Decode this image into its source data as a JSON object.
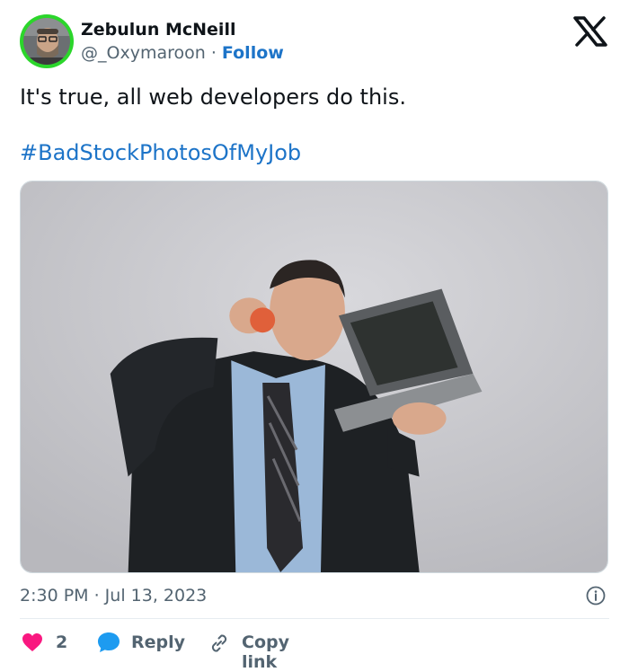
{
  "author": {
    "name": "Zebulun McNeill",
    "handle": "@_Oxymaroon",
    "separator": "·",
    "follow_label": "Follow"
  },
  "tweet": {
    "text": "It's true, all web developers do this.",
    "hashtag": "#BadStockPhotosOfMyJob",
    "timestamp": "2:30 PM · Jul 13, 2023"
  },
  "actions": {
    "like_count": "2",
    "reply_label": "Reply",
    "copy_label": "Copy link"
  },
  "icons": {
    "logo": "x-logo-icon",
    "info": "info-icon",
    "like": "heart-icon",
    "reply": "reply-bubble-icon",
    "copy": "link-icon"
  },
  "colors": {
    "link": "#1d74c8",
    "secondary_text": "#536471",
    "heart": "#f91880",
    "reply_bubble": "#1d9bf0",
    "avatar_ring": "#2bd62b"
  }
}
